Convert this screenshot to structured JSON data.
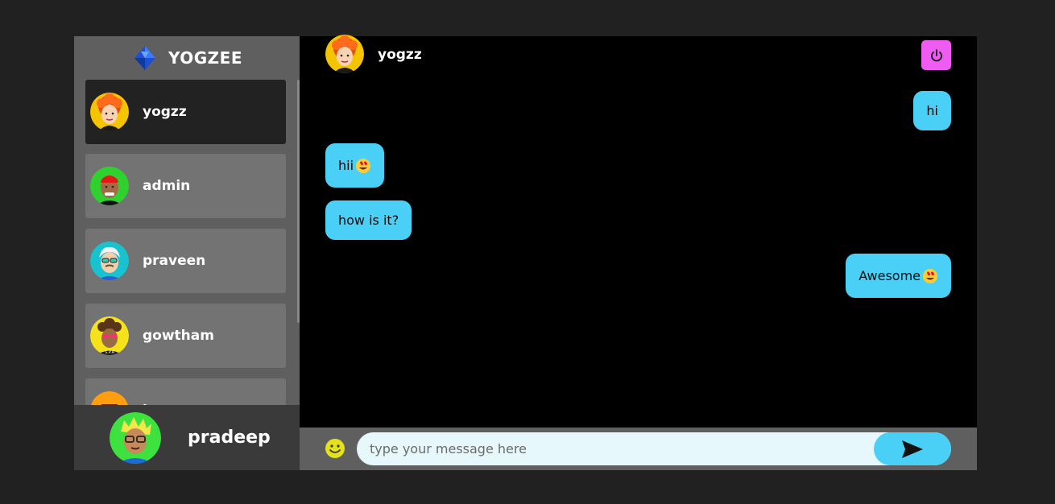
{
  "brand": {
    "name": "YOGZEE",
    "logo_icon": "diamond-logo-icon"
  },
  "contacts": [
    {
      "name": "yogzz",
      "active": true,
      "avatar": "avatar-red-hair"
    },
    {
      "name": "admin",
      "active": false,
      "avatar": "avatar-green-bg"
    },
    {
      "name": "praveen",
      "active": false,
      "avatar": "avatar-white-hair"
    },
    {
      "name": "gowtham",
      "active": false,
      "avatar": "avatar-curly-hair"
    },
    {
      "name": "k",
      "active": false,
      "avatar": "avatar-orange"
    }
  ],
  "current_user": {
    "name": "pradeep",
    "avatar": "avatar-blond-glasses"
  },
  "chat": {
    "user": "yogzz",
    "logout_icon": "power-icon",
    "messages": [
      {
        "text": "hi",
        "sent": true
      },
      {
        "text": "hii",
        "sent": false,
        "emoji": "heart-eyes-emoji"
      },
      {
        "text": "how is it?",
        "sent": false
      },
      {
        "text": "Awesome",
        "sent": true,
        "emoji": "heart-eyes-emoji"
      }
    ]
  },
  "input": {
    "placeholder": "type your message here",
    "value": "",
    "emoji_icon": "smiley-icon",
    "send_icon": "send-icon"
  },
  "colors": {
    "background": "#212121",
    "sidebar": "#5f5f5f",
    "bubble": "#4ad0f6",
    "logout": "#ee5cf1",
    "active_contact": "#222222"
  }
}
